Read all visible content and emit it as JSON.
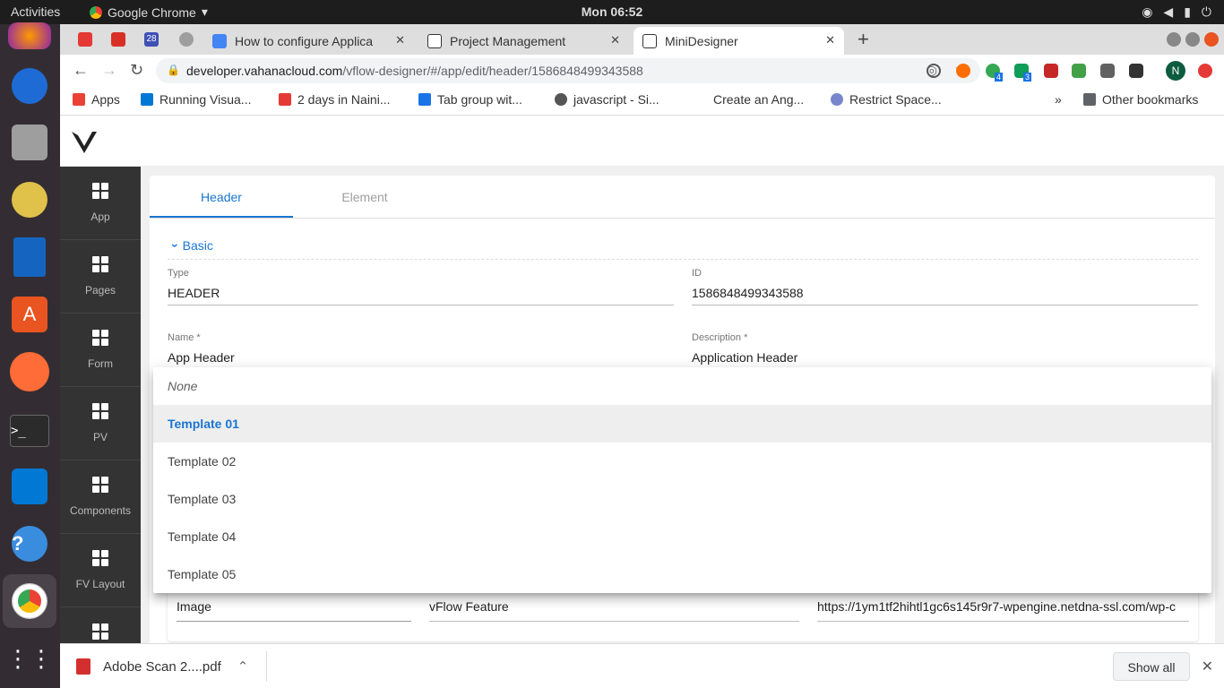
{
  "topbar": {
    "activities": "Activities",
    "app_name": "Google Chrome",
    "clock": "Mon 06:52"
  },
  "tabs": [
    {
      "label": "How to configure Applica"
    },
    {
      "label": "Project Management"
    },
    {
      "label": "MiniDesigner"
    }
  ],
  "pinned_badge": "28",
  "omnibox": {
    "url_host": "developer.vahanacloud.com",
    "url_path": "/vflow-designer/#/app/edit/header/1586848499343588"
  },
  "extensions": {
    "badge_a": "4",
    "badge_b": "3",
    "profile": "N"
  },
  "bookmarks": [
    {
      "label": "Apps"
    },
    {
      "label": "Running Visua..."
    },
    {
      "label": "2 days in Naini..."
    },
    {
      "label": "Tab group wit..."
    },
    {
      "label": "javascript - Si..."
    },
    {
      "label": "Create an Ang..."
    },
    {
      "label": "Restrict Space..."
    },
    {
      "label": "Other bookmarks"
    }
  ],
  "bookmarks_more": "»",
  "sidenav": [
    {
      "label": "App"
    },
    {
      "label": "Pages"
    },
    {
      "label": "Form"
    },
    {
      "label": "PV"
    },
    {
      "label": "Components"
    },
    {
      "label": "FV Layout"
    }
  ],
  "editor": {
    "tab_header": "Header",
    "tab_element": "Element",
    "section": "Basic",
    "type_label": "Type",
    "type_value": "HEADER",
    "id_label": "ID",
    "id_value": "1586848499343588",
    "name_label": "Name *",
    "name_value": "App Header",
    "desc_label": "Description *",
    "desc_value": "Application Header",
    "row_a": "Image",
    "row_b": "vFlow Feature",
    "row_c": "https://1ym1tf2hihtl1gc6s145r9r7-wpengine.netdna-ssl.com/wp-c"
  },
  "dropdown": {
    "options": [
      "None",
      "Template 01",
      "Template 02",
      "Template 03",
      "Template 04",
      "Template 05"
    ],
    "selected": "Template 01"
  },
  "downloads": {
    "file": "Adobe Scan 2....pdf",
    "show_all": "Show all"
  },
  "colors": {
    "accent": "#1976d2",
    "sidenav": "#333333",
    "dock": "#332d33"
  }
}
